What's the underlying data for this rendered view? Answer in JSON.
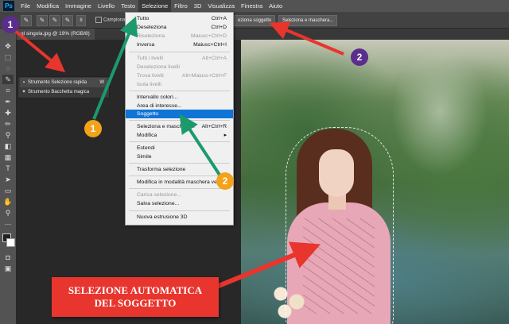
{
  "menubar": {
    "logo": "Ps",
    "items": [
      "File",
      "Modifica",
      "Immagine",
      "Livello",
      "Testo",
      "Selezione",
      "Filtro",
      "3D",
      "Visualizza",
      "Finestra",
      "Aiuto"
    ]
  },
  "options": {
    "sample_all_label": "Campiona t",
    "subject_button": "eziona soggetto",
    "mask_button": "Seleziona e maschera...",
    "brush_size": "8"
  },
  "document": {
    "tab_title": "ql singola.jpg @ 19% (RGB/8)"
  },
  "tool_popup": {
    "items": [
      {
        "label": "Strumento Selezione rapida",
        "key": "W"
      },
      {
        "label": "Strumento Bacchetta magica",
        "key": ""
      }
    ]
  },
  "select_menu": {
    "items": [
      {
        "label": "Tutto",
        "shortcut": "Ctrl+A"
      },
      {
        "label": "Deseleziona",
        "shortcut": "Ctrl+D"
      },
      {
        "label": "Riseleziona",
        "shortcut": "Maiusc+Ctrl+D"
      },
      {
        "label": "Inversa",
        "shortcut": "Maiusc+Ctrl+I"
      },
      {
        "label": "Tutti i livelli",
        "shortcut": "Alt+Ctrl+A"
      },
      {
        "label": "Deseleziona livelli",
        "shortcut": ""
      },
      {
        "label": "Trova livelli",
        "shortcut": "Alt+Maiusc+Ctrl+F"
      },
      {
        "label": "Isola livelli",
        "shortcut": ""
      },
      {
        "label": "Intervallo colori...",
        "shortcut": ""
      },
      {
        "label": "Area di interesse...",
        "shortcut": ""
      },
      {
        "label": "Soggetto",
        "shortcut": ""
      },
      {
        "label": "Seleziona e maschera...",
        "shortcut": "Alt+Ctrl+R"
      },
      {
        "label": "Modifica",
        "shortcut": "▸"
      },
      {
        "label": "Estendi",
        "shortcut": ""
      },
      {
        "label": "Simile",
        "shortcut": ""
      },
      {
        "label": "Trasforma selezione",
        "shortcut": ""
      },
      {
        "label": "Modifica in modalità maschera veloce",
        "shortcut": ""
      },
      {
        "label": "Carica selezione...",
        "shortcut": ""
      },
      {
        "label": "Salva selezione...",
        "shortcut": ""
      },
      {
        "label": "Nuova estrusione 3D",
        "shortcut": ""
      }
    ]
  },
  "badges": {
    "purple_1": "1",
    "purple_2": "2",
    "orange_1": "1",
    "orange_2": "2"
  },
  "caption": {
    "line1": "SELEZIONE AUTOMATICA",
    "line2": "DEL SOGGETTO"
  },
  "colors": {
    "highlight": "#0f74d6",
    "purple_badge": "#5b2d8c",
    "orange_badge": "#f4a21a",
    "red_arrow": "#e8352e",
    "green_arrow": "#1b9a6b"
  }
}
